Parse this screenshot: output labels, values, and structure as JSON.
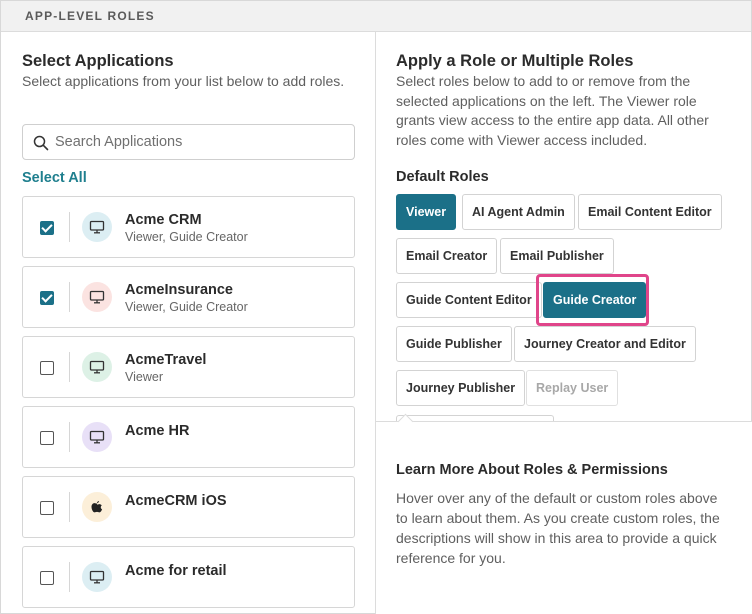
{
  "section": {
    "header": "APP-LEVEL ROLES"
  },
  "left": {
    "title": "Select Applications",
    "description": "Select applications from your list below to add roles.",
    "search_placeholder": "Search Applications",
    "select_all": "Select All",
    "apps": [
      {
        "name": "Acme CRM",
        "roles": "Viewer, Guide Creator",
        "checked": true,
        "icon": "monitor-icon",
        "icon_bg": "#dceef3"
      },
      {
        "name": "AcmeInsurance",
        "roles": "Viewer, Guide Creator",
        "checked": true,
        "icon": "monitor-icon",
        "icon_bg": "#fbe3e1"
      },
      {
        "name": "AcmeTravel",
        "roles": "Viewer",
        "checked": false,
        "icon": "monitor-icon",
        "icon_bg": "#ddf1e6"
      },
      {
        "name": "Acme HR",
        "roles": "",
        "checked": false,
        "icon": "monitor-icon",
        "icon_bg": "#e8e0f7"
      },
      {
        "name": "AcmeCRM iOS",
        "roles": "",
        "checked": false,
        "icon": "apple-icon",
        "icon_bg": "#fcefd9"
      },
      {
        "name": "Acme for retail",
        "roles": "",
        "checked": false,
        "icon": "monitor-icon",
        "icon_bg": "#dceef3"
      }
    ]
  },
  "right": {
    "title": "Apply a Role or Multiple Roles",
    "description": "Select roles below to add to or remove from the selected applications on the left. The Viewer role grants view access to the entire app data. All other roles come with Viewer access included.",
    "default_roles_label": "Default Roles",
    "roles": [
      {
        "label": "Viewer",
        "state": "selected"
      },
      {
        "label": "AI Agent Admin",
        "state": "normal"
      },
      {
        "label": "Email Content Editor",
        "state": "normal"
      },
      {
        "label": "Email Creator",
        "state": "normal"
      },
      {
        "label": "Email Publisher",
        "state": "normal"
      },
      {
        "label": "Guide Content Editor",
        "state": "normal"
      },
      {
        "label": "Guide Creator",
        "state": "selected"
      },
      {
        "label": "Guide Publisher",
        "state": "normal"
      },
      {
        "label": "Journey Creator and Editor",
        "state": "normal"
      },
      {
        "label": "Journey Publisher",
        "state": "normal"
      },
      {
        "label": "Replay User",
        "state": "disabled"
      }
    ],
    "learn_more": {
      "title": "Learn More About Roles & Permissions",
      "description": "Hover over any of the default or custom roles above to learn about them. As you create custom roles, the descriptions will show in this area to provide a quick reference for you."
    }
  },
  "colors": {
    "accent": "#1b7088",
    "link": "#1f7f8e",
    "highlight": "#e0458a"
  }
}
